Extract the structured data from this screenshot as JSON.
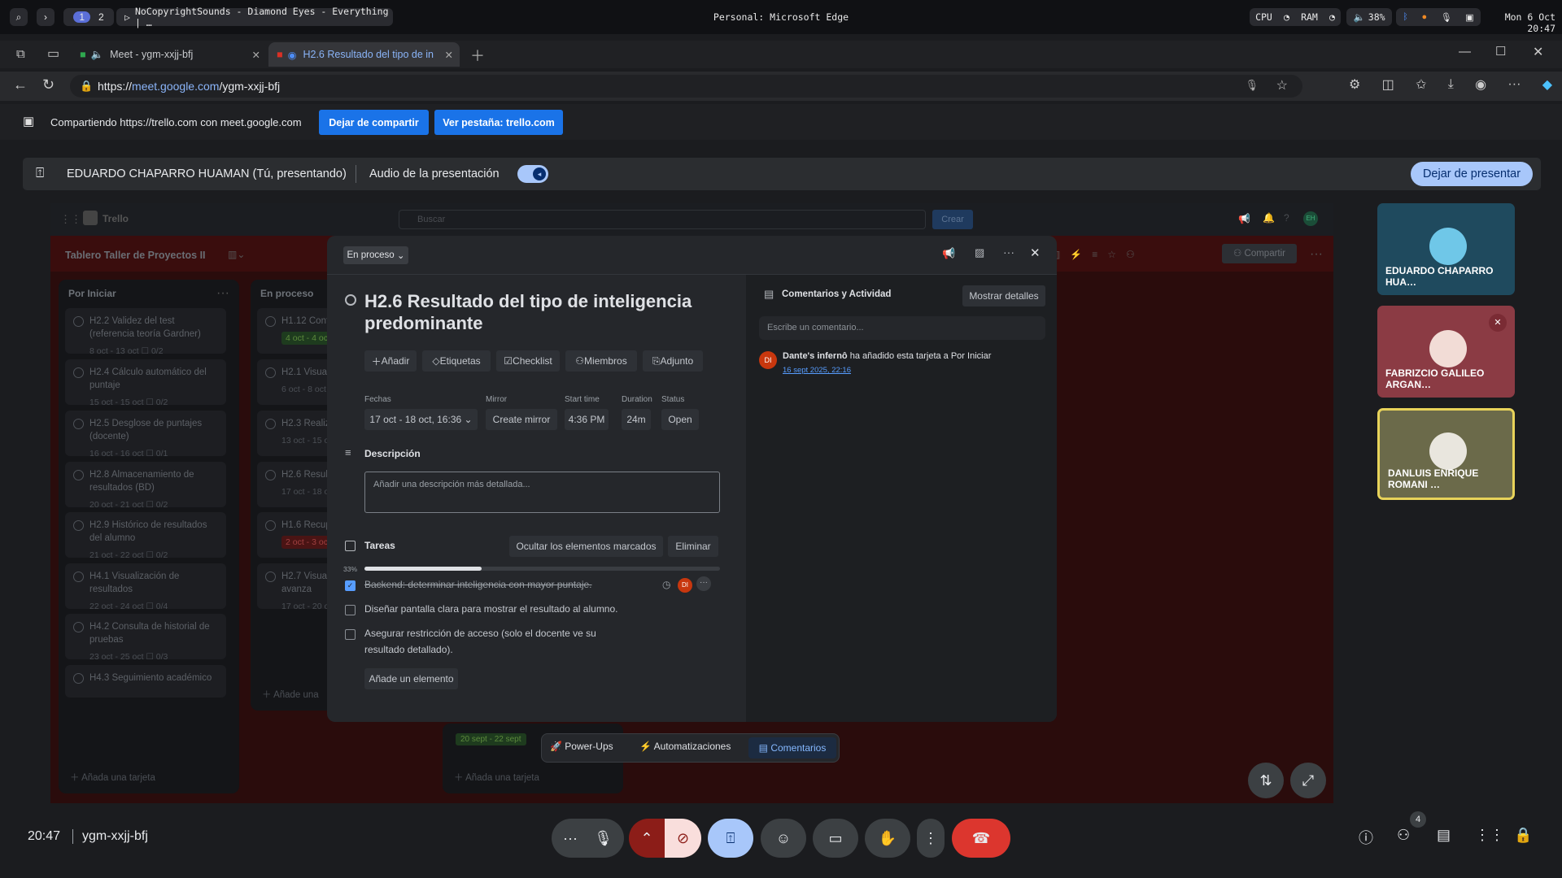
{
  "os": {
    "workspace_1": "1",
    "workspace_2": "2",
    "now_playing": "NoCopyrightSounds - Diamond Eyes - Everything | …",
    "window_title": "Personal: Microsoft Edge",
    "cpu_label": "CPU",
    "ram_label": "RAM",
    "volume": "38%",
    "clock": "Mon 6 Oct 20:47"
  },
  "browser": {
    "tabs": [
      {
        "label": "Meet - ygm-xxjj-bfj"
      },
      {
        "label": "H2.6 Resultado del tipo de in"
      }
    ],
    "url_prefix": "https://",
    "url_host": "meet.google.com",
    "url_path": "/ygm-xxjj-bfj"
  },
  "sharebar": {
    "text": "Compartiendo https://trello.com con meet.google.com",
    "stop_label": "Dejar de compartir",
    "view_label": "Ver pestaña: trello.com"
  },
  "presenting": {
    "presenter": "EDUARDO CHAPARRO HUAMAN (Tú, presentando)",
    "audio_label": "Audio de la presentación",
    "stop_label": "Dejar de presentar"
  },
  "trello": {
    "logo": "Trello",
    "search_placeholder": "Buscar",
    "create_label": "Crear",
    "avatar": "EH",
    "board_title": "Tablero Taller de Proyectos II",
    "share_label": "Compartir",
    "columns": [
      {
        "title": "Por Iniciar",
        "add": "Añada una tarjeta"
      },
      {
        "title": "En proceso",
        "add": "Añade una"
      },
      {
        "add": "Añada una tarjeta"
      }
    ],
    "col1_cards": [
      {
        "title": "H2.2 Validez del test (referencia teoría Gardner)",
        "meta": "8 oct - 13 oct   ☐ 0/2"
      },
      {
        "title": "H2.4 Cálculo automático del puntaje",
        "meta": "15 oct - 15 oct   ☐ 0/2"
      },
      {
        "title": "H2.5 Desglose de puntajes (docente)",
        "meta": "16 oct - 16 oct   ☐ 0/1"
      },
      {
        "title": "H2.8 Almacenamiento de resultados (BD)",
        "meta": "20 oct - 21 oct   ☐ 0/2"
      },
      {
        "title": "H2.9 Histórico de resultados del alumno",
        "meta": "21 oct - 22 oct   ☐ 0/2"
      },
      {
        "title": "H4.1 Visualización de resultados",
        "meta": "22 oct - 24 oct   ☐ 0/4"
      },
      {
        "title": "H4.2 Consulta de historial de pruebas",
        "meta": "23 oct - 25 oct   ☐ 0/3"
      },
      {
        "title": "H4.3 Seguimiento académico",
        "meta": ""
      }
    ],
    "col2_cards": [
      {
        "title": "H1.12 Conf sesión",
        "meta": "4 oct - 4 oct"
      },
      {
        "title": "H2.1 Visual",
        "meta": "6 oct - 8 oct"
      },
      {
        "title": "H2.3 Realiz validación)",
        "meta": "13 oct - 15 o"
      },
      {
        "title": "H2.6 Result inteligencia",
        "meta": "17 oct - 18 o"
      },
      {
        "title": "H1.6 Recup alumnos",
        "meta": "2 oct - 3 oct"
      },
      {
        "title": "H2.7 Visual resultado (h más avanza",
        "meta": "17 oct - 20 o"
      }
    ],
    "col3_meta": "20 sept - 22 sept"
  },
  "modal": {
    "list_badge": "En proceso",
    "title": "H2.6 Resultado del tipo de inteligencia predominante",
    "actions": [
      "Añadir",
      "Etiquetas",
      "Checklist",
      "Miembros",
      "Adjunto"
    ],
    "fields": {
      "dates_label": "Fechas",
      "dates_value": "17 oct - 18 oct, 16:36",
      "mirror_label": "Mirror",
      "mirror_value": "Create mirror",
      "start_label": "Start time",
      "start_value": "4:36 PM",
      "duration_label": "Duration",
      "duration_value": "24m",
      "status_label": "Status",
      "status_value": "Open"
    },
    "description_label": "Descripción",
    "description_placeholder": "Añadir una descripción más detallada...",
    "tasks_label": "Tareas",
    "hide_checked": "Ocultar los elementos marcados",
    "delete_label": "Eliminar",
    "progress_text": "33%",
    "progress": 0.33,
    "tasks": [
      {
        "text": "Backend: determinar inteligencia con mayor puntaje.",
        "done": true
      },
      {
        "text": "Diseñar pantalla clara para mostrar el resultado al alumno.",
        "done": false
      },
      {
        "text": "Asegurar restricción de acceso (solo el docente ve su resultado detallado).",
        "done": false
      }
    ],
    "task_member": "DI",
    "add_item": "Añade un elemento",
    "comments_title": "Comentarios y Actividad",
    "show_details": "Mostrar detalles",
    "comment_placeholder": "Escribe un comentario...",
    "activity_avatar": "DI",
    "activity_user": "Dante's infernô",
    "activity_text": " ha añadido esta tarjeta a Por Iniciar",
    "activity_time": "16 sept 2025, 22:16"
  },
  "trello_footer": {
    "powerups": "Power-Ups",
    "automations": "Automatizaciones",
    "comments": "Comentarios"
  },
  "participants": [
    {
      "name": "EDUARDO CHAPARRO HUA…",
      "bg": "#1f4a5e"
    },
    {
      "name": "FABRIZCIO GALILEO ARGAN…",
      "bg": "#8b3b44"
    },
    {
      "name": "DANLUIS ENRIQUE ROMANI …",
      "bg": "#6b6a4a"
    }
  ],
  "meet": {
    "time": "20:47",
    "meeting_code": "ygm-xxjj-bfj",
    "people_count": "4",
    "accent": "#a8c7fa",
    "end_call_color": "#dc362e"
  }
}
